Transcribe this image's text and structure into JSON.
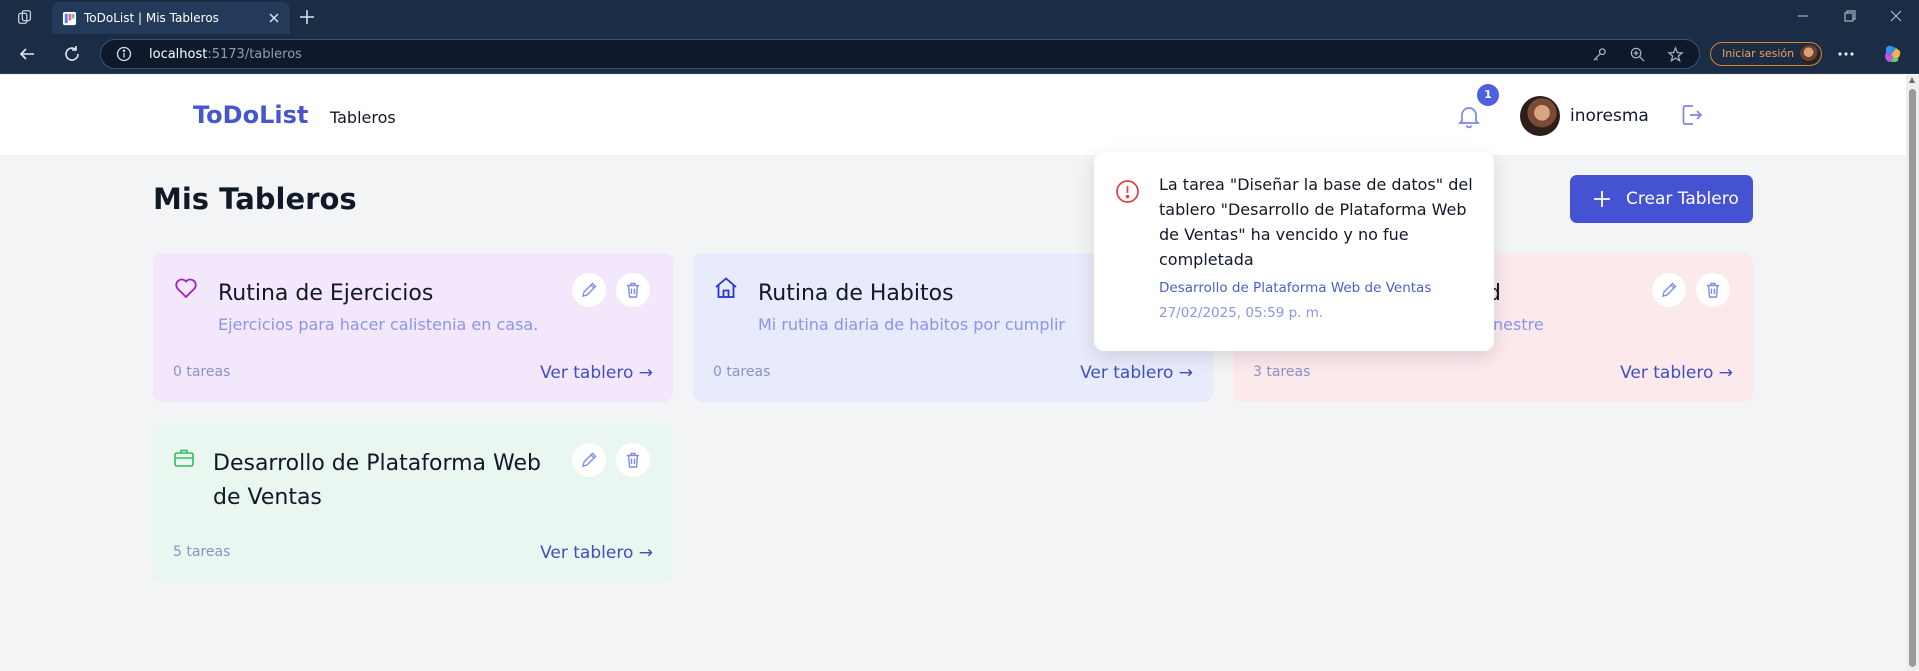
{
  "browser": {
    "tab_title": "ToDoList | Mis Tableros",
    "url_host": "localhost",
    "url_path": ":5173/tableros",
    "signin_label": "Iniciar sesión"
  },
  "navbar": {
    "brand": "ToDoList",
    "nav_link": "Tableros",
    "notifications_count": "1",
    "username": "inoresma"
  },
  "main": {
    "title": "Mis Tableros",
    "create_button": "Crear Tablero"
  },
  "boards": [
    {
      "title": "Rutina de Ejercicios",
      "description": "Ejercicios para hacer calistenia en casa.",
      "count": "0 tareas",
      "link": "Ver tablero →",
      "icon": "heart-icon",
      "color": "#f3e8fb"
    },
    {
      "title": "Rutina de Habitos",
      "description": "Mi rutina diaria de habitos por cumplir",
      "count": "0 tareas",
      "link": "Ver tablero →",
      "icon": "home-icon",
      "color": "#e8ebfb"
    },
    {
      "title": "nd",
      "description": "nestre",
      "count": "3 tareas",
      "link": "Ver tablero →",
      "icon": "",
      "color": "#fbe9ec"
    },
    {
      "title": "Desarrollo de Plataforma Web de Ventas",
      "description": "",
      "count": "5 tareas",
      "link": "Ver tablero →",
      "icon": "briefcase-icon",
      "color": "#eaf6f0"
    }
  ],
  "notification": {
    "message": "La tarea \"Diseñar la base de datos\" del tablero \"Desarrollo de Plataforma Web de Ventas\" ha vencido y no fue completada",
    "board": "Desarrollo de Plataforma Web de Ventas",
    "date": "27/02/2025, 05:59 p. m.",
    "icon": "alert-circle-icon"
  }
}
